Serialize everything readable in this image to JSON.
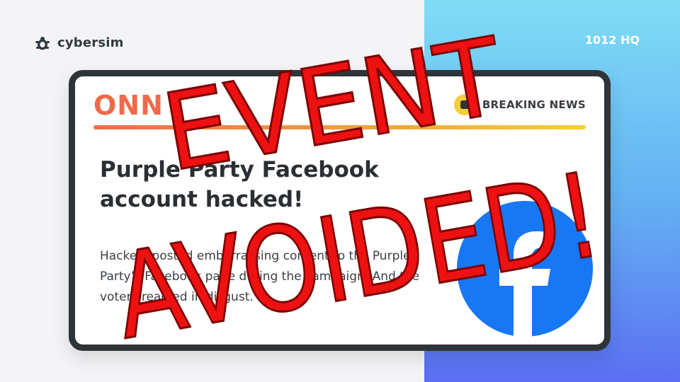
{
  "brand": {
    "name": "cybersim",
    "logo_icon": "turtle-icon"
  },
  "location_label": "1012 HQ",
  "news": {
    "outlet": "ONN",
    "breaking_label": "BREAKING NEWS",
    "breaking_icon": "alert-icon",
    "headline": "Purple Party Facebook account hacked!",
    "body": "Hackers posted embarrassing content to the Purple Party’s Facebook page during the campaign. And the voters reacted in disgust.",
    "image_icon": "facebook-logo-icon"
  },
  "stamp": {
    "line1": "EVENT",
    "line2": "AVOIDED!"
  },
  "colors": {
    "accent_orange": "#f06a4a",
    "accent_yellow": "#f4cf3a",
    "facebook_blue": "#1877f2",
    "stamp_red": "#ee1111",
    "panel_gradient_top": "#7fdcf5",
    "panel_gradient_bottom": "#5b6ef2"
  }
}
